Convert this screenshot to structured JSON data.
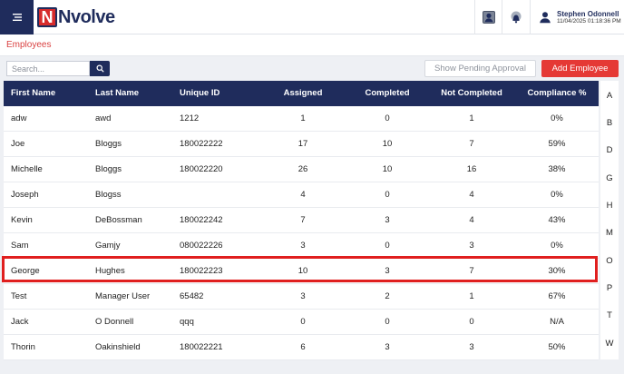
{
  "header": {
    "brand_letter": "N",
    "brand_name": "Nvolve",
    "user_name": "Stephen Odonnell",
    "timestamp": "11/04/2025 01:18:36 PM"
  },
  "breadcrumb": "Employees",
  "search": {
    "placeholder": "Search..."
  },
  "buttons": {
    "pending": "Show Pending Approval",
    "add": "Add Employee"
  },
  "table": {
    "columns": [
      "First Name",
      "Last Name",
      "Unique ID",
      "Assigned",
      "Completed",
      "Not Completed",
      "Compliance %"
    ],
    "rows": [
      [
        "adw",
        "awd",
        "1212",
        "1",
        "0",
        "1",
        "0%"
      ],
      [
        "Joe",
        "Bloggs",
        "180022222",
        "17",
        "10",
        "7",
        "59%"
      ],
      [
        "Michelle",
        "Bloggs",
        "180022220",
        "26",
        "10",
        "16",
        "38%"
      ],
      [
        "Joseph",
        "Blogss",
        "",
        "4",
        "0",
        "4",
        "0%"
      ],
      [
        "Kevin",
        "DeBossman",
        "180022242",
        "7",
        "3",
        "4",
        "43%"
      ],
      [
        "Sam",
        "Gamjy",
        "080022226",
        "3",
        "0",
        "3",
        "0%"
      ],
      [
        "George",
        "Hughes",
        "180022223",
        "10",
        "3",
        "7",
        "30%"
      ],
      [
        "Test",
        "Manager User",
        "65482",
        "3",
        "2",
        "1",
        "67%"
      ],
      [
        "Jack",
        "O Donnell",
        "qqq",
        "0",
        "0",
        "0",
        "N/A"
      ],
      [
        "Thorin",
        "Oakinshield",
        "180022221",
        "6",
        "3",
        "3",
        "50%"
      ]
    ],
    "highlighted_row": 6
  },
  "alphabet": [
    "A",
    "B",
    "D",
    "G",
    "H",
    "M",
    "O",
    "P",
    "T",
    "W"
  ],
  "colors": {
    "navy": "#1f2c5c",
    "accent_red": "#e53935",
    "highlight": "#e01f1f"
  },
  "icons": {
    "menu": "menu-icon",
    "search": "search-icon",
    "profile_card": "profile-card-icon",
    "bell": "bell-icon",
    "user": "user-icon"
  }
}
